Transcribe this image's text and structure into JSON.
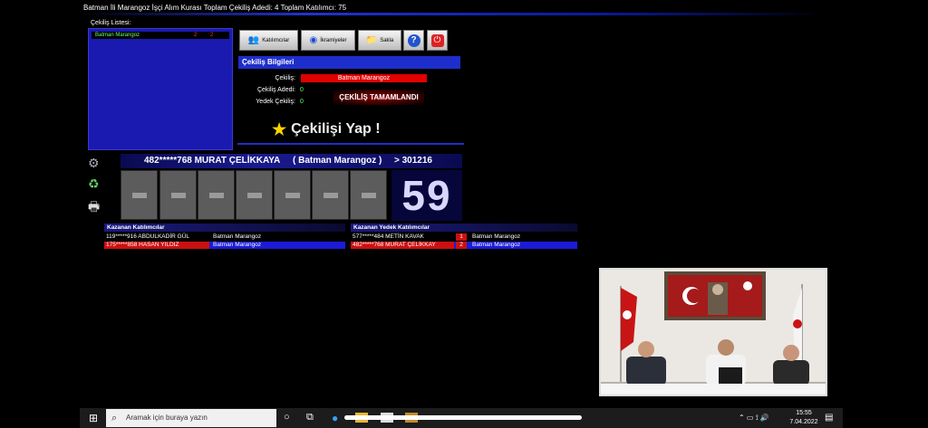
{
  "app": {
    "title": "Batman İli Marangoz İşçi Alım Kurası   Toplam Çekiliş Adedi: 4   Toplam Katılımcı: 75"
  },
  "list": {
    "label": "Çekiliş Listesi:",
    "items": [
      {
        "name": "Batman Marangoz",
        "count1": "2",
        "count2": "2"
      }
    ]
  },
  "toolbar": {
    "participants_label": "Katılımcılar",
    "bonus_label": "İkramiyeler",
    "save_label": "Sakla"
  },
  "info": {
    "header": "Çekiliş Bilgileri",
    "draw_label": "Çekiliş:",
    "draw_value": "Batman Marangoz",
    "count_label": "Çekiliş Adedi:",
    "count_value": "0",
    "reserve_label": "Yedek Çekiliş:",
    "reserve_value": "0",
    "status": "ÇEKİLİŞ  TAMAMLANDI",
    "action_label": "Çekilişi Yap !"
  },
  "result": {
    "winner_id": "482*****768 MURAT ÇELİKKAYA",
    "winner_group": "( Batman Marangoz )",
    "winner_code": "> 301216",
    "number": "59"
  },
  "winners": {
    "header": "Kazanan Katılımcılar",
    "rows": [
      {
        "id": "119*****916 ABDULKADİR GÜL",
        "group": "Batman Marangoz"
      },
      {
        "id": "175*****858 HASAN YILDIZ",
        "group": "Batman Marangoz"
      }
    ]
  },
  "reserves": {
    "header": "Kazanan Yedek Katılımcılar",
    "rows": [
      {
        "id": "577*****484 METİN KAVAK",
        "rank": "1",
        "group": "Batman Marangoz"
      },
      {
        "id": "482*****768 MURAT ÇELİKKAY",
        "rank": "2",
        "group": "Batman Marangoz"
      }
    ]
  },
  "taskbar": {
    "search_placeholder": "Aramak için buraya yazın",
    "time": "15:55",
    "date": "7.04.2022"
  },
  "colors": {
    "accent_blue": "#1e2ecc",
    "highlight_red": "#e00000",
    "value_green": "#5cff5c"
  }
}
